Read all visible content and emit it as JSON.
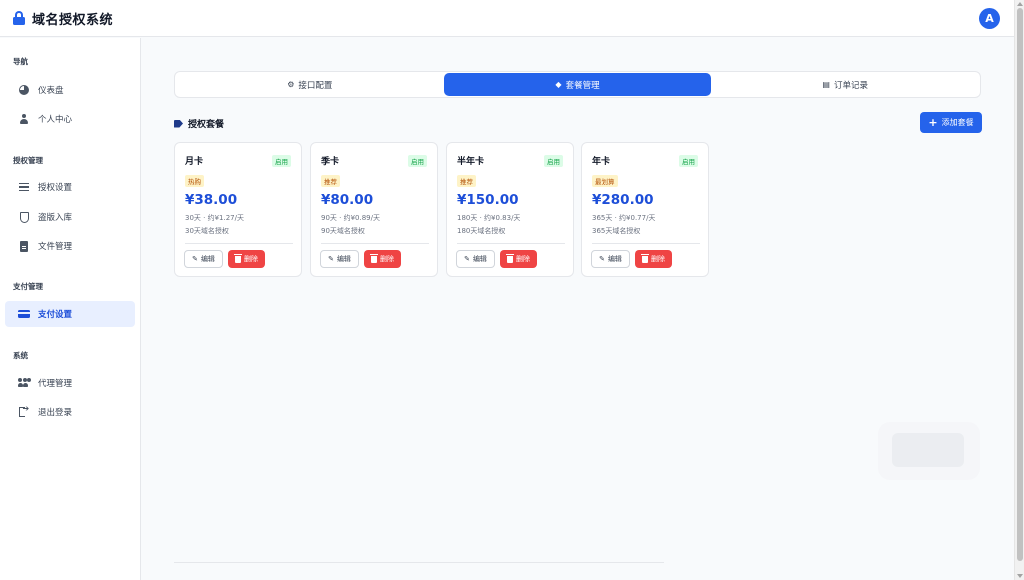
{
  "header": {
    "title": "域名授权系统",
    "avatar_initial": "A"
  },
  "sidebar": {
    "sections": [
      {
        "title": "导航",
        "items": [
          {
            "label": "仪表盘",
            "icon": "pie-chart-icon"
          },
          {
            "label": "个人中心",
            "icon": "user-icon"
          }
        ]
      },
      {
        "title": "授权管理",
        "items": [
          {
            "label": "授权设置",
            "icon": "sliders-icon"
          },
          {
            "label": "盗版入库",
            "icon": "shield-icon"
          },
          {
            "label": "文件管理",
            "icon": "file-icon"
          }
        ]
      },
      {
        "title": "支付管理",
        "items": [
          {
            "label": "支付设置",
            "icon": "credit-card-icon",
            "active": true
          }
        ]
      },
      {
        "title": "系统",
        "items": [
          {
            "label": "代理管理",
            "icon": "users-icon"
          },
          {
            "label": "退出登录",
            "icon": "logout-icon"
          }
        ]
      }
    ]
  },
  "tabs": [
    {
      "label": "接口配置",
      "icon": "gear-icon",
      "active": false
    },
    {
      "label": "套餐管理",
      "icon": "tag-icon",
      "active": true
    },
    {
      "label": "订单记录",
      "icon": "receipt-icon",
      "active": false
    }
  ],
  "packages": {
    "title": "授权套餐",
    "add_label": "添加套餐",
    "items": [
      {
        "name": "月卡",
        "status": "启用",
        "badge": "热购",
        "price": "¥38.00",
        "desc1": "30天 · 约¥1.27/天",
        "desc2": "30天域名授权",
        "edit": "编辑",
        "delete": "删除"
      },
      {
        "name": "季卡",
        "status": "启用",
        "badge": "推荐",
        "price": "¥80.00",
        "desc1": "90天 · 约¥0.89/天",
        "desc2": "90天域名授权",
        "edit": "编辑",
        "delete": "删除"
      },
      {
        "name": "半年卡",
        "status": "启用",
        "badge": "推荐",
        "price": "¥150.00",
        "desc1": "180天 · 约¥0.83/天",
        "desc2": "180天域名授权",
        "edit": "编辑",
        "delete": "删除"
      },
      {
        "name": "年卡",
        "status": "启用",
        "badge": "最划算",
        "price": "¥280.00",
        "desc1": "365天 · 约¥0.77/天",
        "desc2": "365天域名授权",
        "edit": "编辑",
        "delete": "删除"
      }
    ]
  },
  "colors": {
    "primary": "#2563eb",
    "danger": "#ef4444",
    "success": "#16a34a",
    "warning": "#b45309"
  }
}
